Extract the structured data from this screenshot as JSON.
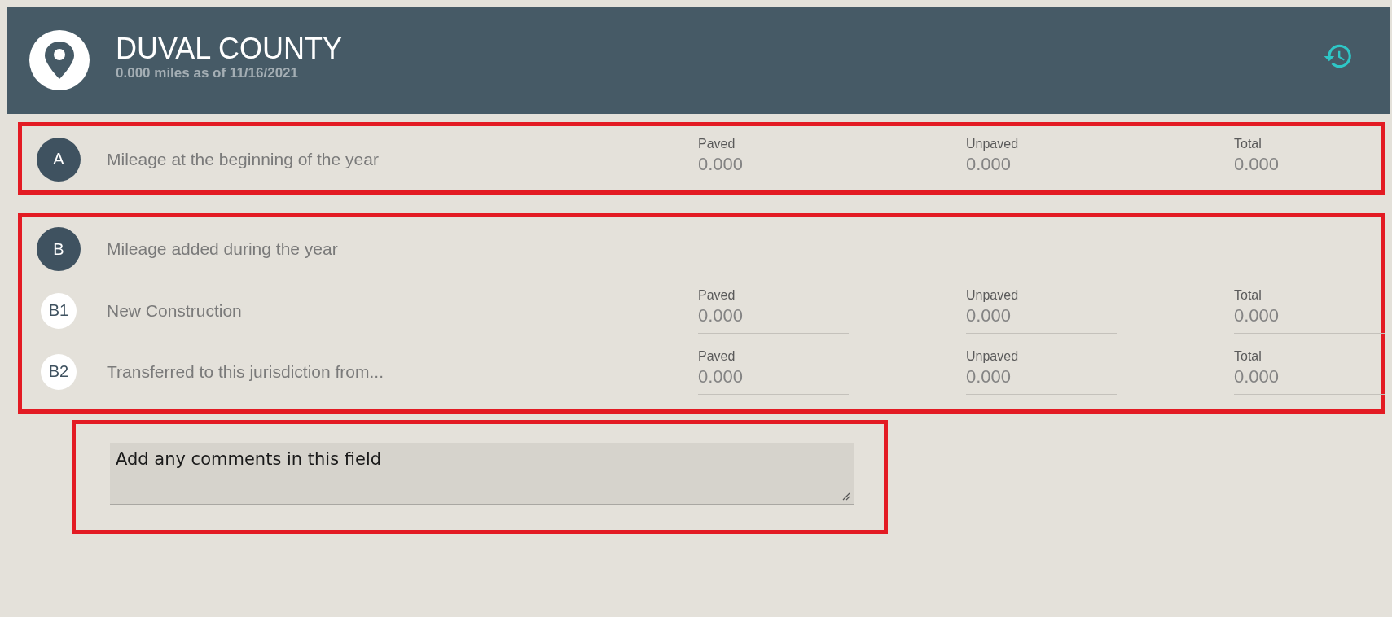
{
  "header": {
    "title": "DUVAL COUNTY",
    "subtitle": "0.000 miles as of 11/16/2021"
  },
  "sections": [
    {
      "rows": [
        {
          "kind": "section",
          "badge": "A",
          "label": "Mileage at the beginning of the year",
          "fields": [
            {
              "label": "Paved",
              "value": "0.000"
            },
            {
              "label": "Unpaved",
              "value": "0.000"
            },
            {
              "label": "Total",
              "value": "0.000"
            }
          ]
        }
      ]
    },
    {
      "rows": [
        {
          "kind": "section",
          "badge": "B",
          "label": "Mileage added during the year",
          "fields": []
        },
        {
          "kind": "item",
          "badge": "B1",
          "label": "New Construction",
          "fields": [
            {
              "label": "Paved",
              "value": "0.000"
            },
            {
              "label": "Unpaved",
              "value": "0.000"
            },
            {
              "label": "Total",
              "value": "0.000"
            }
          ]
        },
        {
          "kind": "item",
          "badge": "B2",
          "label": "Transferred to this jurisdiction from...",
          "fields": [
            {
              "label": "Paved",
              "value": "0.000"
            },
            {
              "label": "Unpaved",
              "value": "0.000"
            },
            {
              "label": "Total",
              "value": "0.000"
            }
          ]
        }
      ]
    }
  ],
  "comments": {
    "value": "Add any comments in this field"
  }
}
